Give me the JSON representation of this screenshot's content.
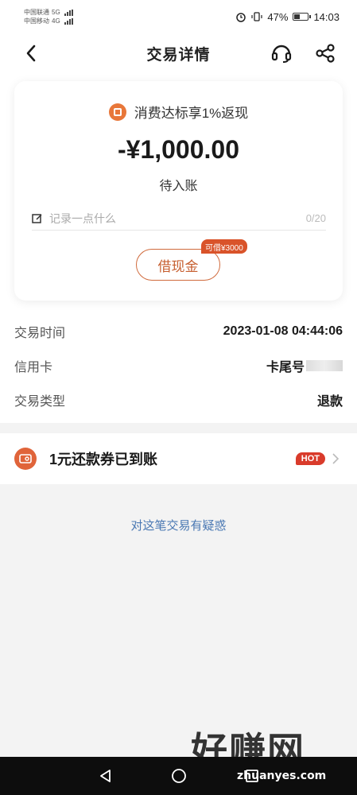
{
  "status_bar": {
    "carrier_1": "中国联通",
    "carrier_1_net": "5G",
    "carrier_2": "中国移动",
    "carrier_2_net": "4G",
    "battery_percent": "47%",
    "battery_level": 0.47,
    "time": "14:03"
  },
  "header": {
    "title": "交易详情",
    "back_icon": "back-arrow-icon",
    "support_icon": "headset-icon",
    "share_icon": "share-icon"
  },
  "card": {
    "promo_text": "消费达标享1%返现",
    "amount": "-¥1,000.00",
    "status": "待入账",
    "note_placeholder": "记录一点什么",
    "note_value": "",
    "note_count": "0/20",
    "borrow_button": "借现金",
    "borrow_badge": "可借¥3000"
  },
  "details": [
    {
      "label": "交易时间",
      "value": "2023-01-08 04:44:06"
    },
    {
      "label": "信用卡",
      "value": "卡尾号"
    },
    {
      "label": "交易类型",
      "value": "退款"
    }
  ],
  "coupon": {
    "text": "1元还款券已到账",
    "badge": "HOT"
  },
  "dispute_link": "对这笔交易有疑惑",
  "watermark": {
    "text": "好赚网",
    "sub": "zhuanyes.com"
  },
  "colors": {
    "accent": "#d06a3c",
    "hot": "#d93b2b",
    "link": "#4a78b3"
  }
}
